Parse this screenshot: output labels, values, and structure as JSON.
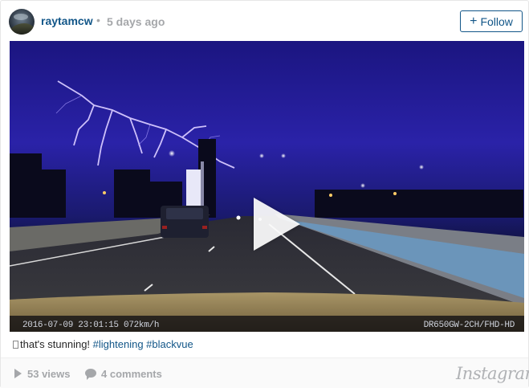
{
  "header": {
    "username": "raytamcw",
    "separator": "•",
    "timestamp": "5 days ago",
    "follow_label": "Follow",
    "follow_icon": "+"
  },
  "video": {
    "overlay_left": "2016-07-09  23:01:15   072km/h",
    "overlay_right": "DR650GW-2CH/FHD-HD",
    "sky_color": "#2a22a8",
    "play_icon": "play-icon"
  },
  "caption": {
    "text": "that's stunning! ",
    "tags": [
      "#lightening",
      "#blackvue"
    ]
  },
  "footer": {
    "views": "53 views",
    "comments": "4 comments",
    "brand": "Instagram"
  },
  "colors": {
    "link": "#125688",
    "muted": "#a5a7aa"
  }
}
